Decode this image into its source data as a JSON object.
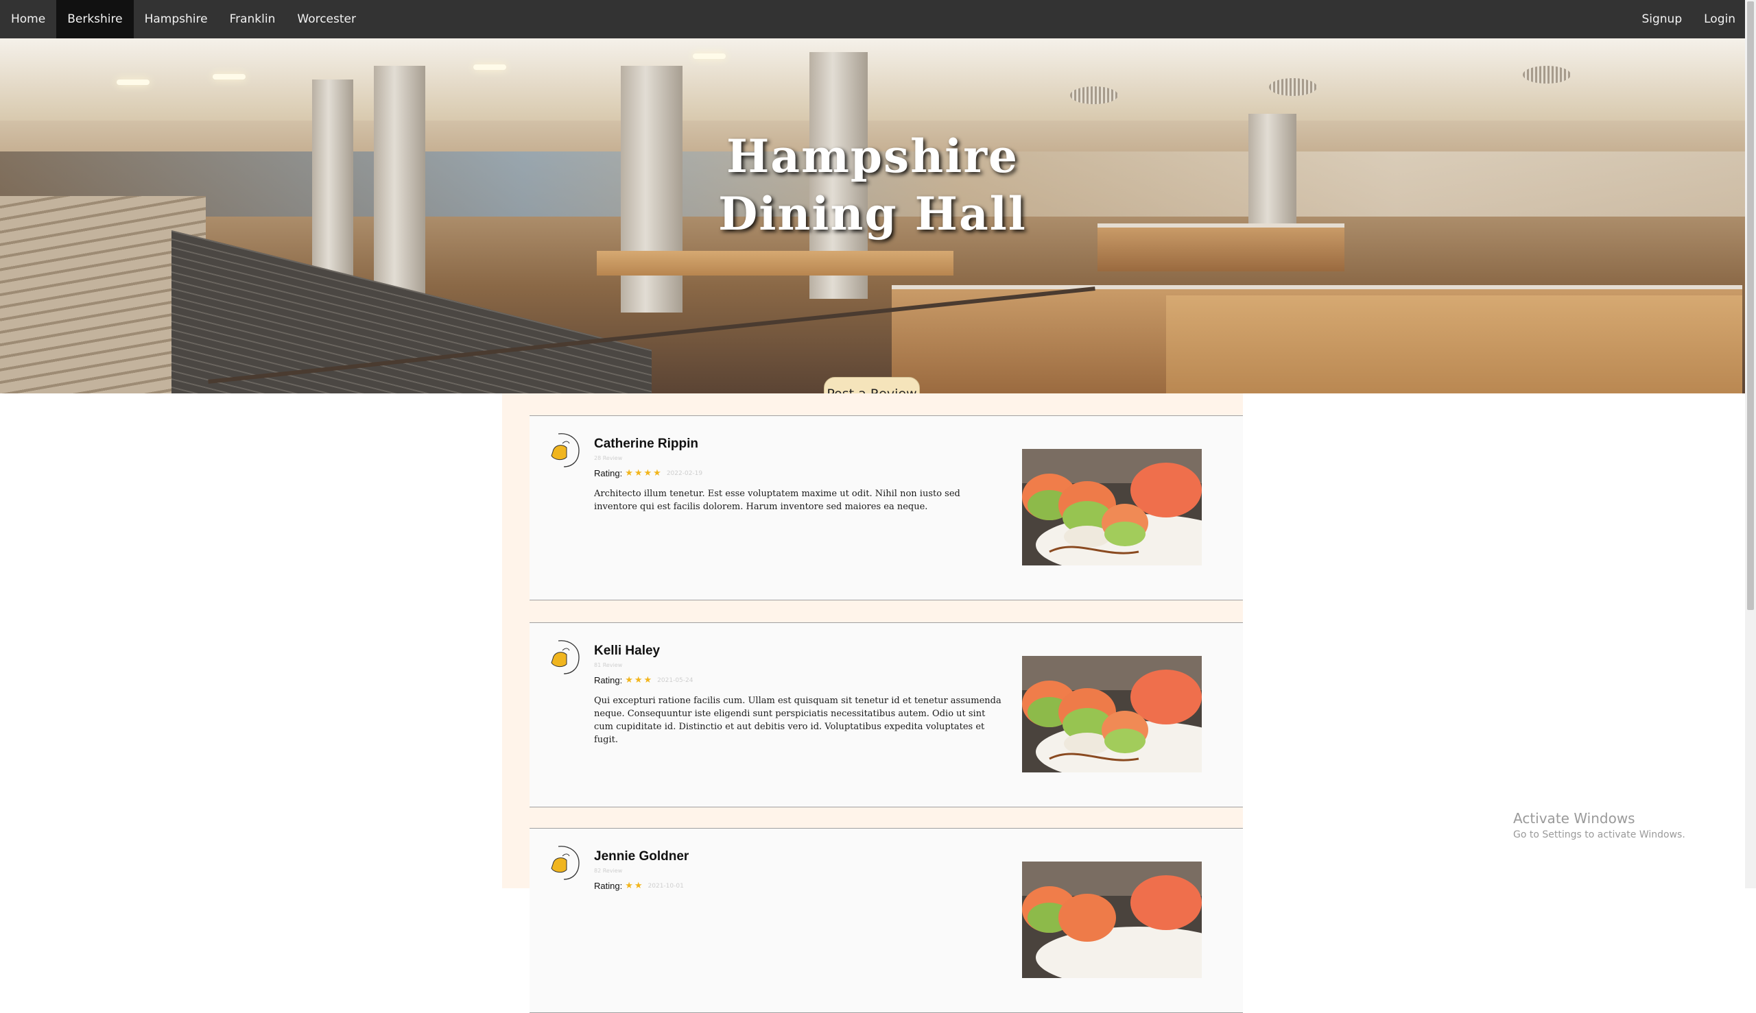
{
  "nav": {
    "left": [
      {
        "label": "Home",
        "active": false
      },
      {
        "label": "Berkshire",
        "active": true
      },
      {
        "label": "Hampshire",
        "active": false
      },
      {
        "label": "Franklin",
        "active": false
      },
      {
        "label": "Worcester",
        "active": false
      }
    ],
    "right": [
      {
        "label": "Signup"
      },
      {
        "label": "Login"
      }
    ]
  },
  "hero": {
    "title_line1": "Hampshire",
    "title_line2": "Dining Hall",
    "post_review_label": "Post a Review"
  },
  "reviews": [
    {
      "name": "Catherine Rippin",
      "review_count": "28 Review",
      "rating_label": "Rating:",
      "stars": 4,
      "stars_text": "★★★★",
      "date": "2022-02-19",
      "text": "Architecto illum tenetur. Est esse voluptatem maxime ut odit. Nihil non iusto sed inventore qui est facilis dolorem. Harum inventore sed maiores ea neque."
    },
    {
      "name": "Kelli Haley",
      "review_count": "81 Review",
      "rating_label": "Rating:",
      "stars": 3,
      "stars_text": "★★★",
      "date": "2021-05-24",
      "text": "Qui excepturi ratione facilis cum. Ullam est quisquam sit tenetur id et tenetur assumenda neque. Consequuntur iste eligendi sunt perspiciatis necessitatibus autem. Odio ut sint cum cupiditate id. Distinctio et aut debitis vero id. Voluptatibus expedita voluptates et fugit."
    },
    {
      "name": "Jennie Goldner",
      "review_count": "82 Review",
      "rating_label": "Rating:",
      "stars": 2,
      "stars_text": "★★",
      "date": "2021-10-01",
      "text": ""
    }
  ],
  "watermark": {
    "line1": "Activate Windows",
    "line2": "Go to Settings to activate Windows."
  },
  "colors": {
    "navbar": "#333333",
    "nav_active": "#111111",
    "post_button": "#f5e4bb",
    "star": "#f2b51c",
    "reviews_bg": "#fff4ea"
  },
  "icons": [
    "avatar-duck-icon",
    "star-icon"
  ]
}
